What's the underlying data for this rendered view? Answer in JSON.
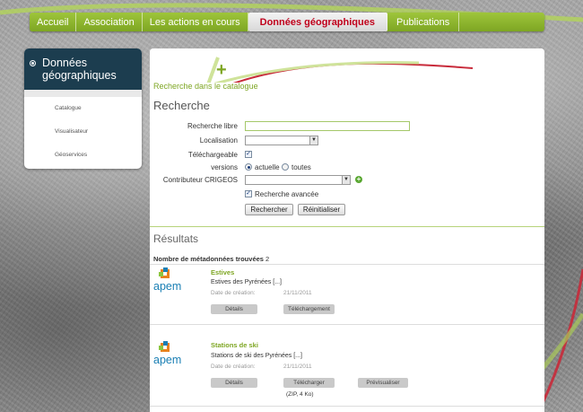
{
  "colors": {
    "nav_green": "#8fb82f",
    "nav_active_text": "#c0001b",
    "sidebar_header": "#1c3d4f",
    "link_green": "#7ea623",
    "apem_blue": "#1a7fb4"
  },
  "nav": {
    "items": [
      {
        "label": "Accueil"
      },
      {
        "label": "Association"
      },
      {
        "label": "Les actions en cours"
      },
      {
        "label": "Données géographiques",
        "active": true
      },
      {
        "label": "Publications"
      }
    ]
  },
  "sidebar": {
    "title_line1": "Données",
    "title_line2": "géographiques",
    "items": [
      {
        "label": "Catalogue"
      },
      {
        "label": "Visualisateur"
      },
      {
        "label": "Géoservices"
      }
    ]
  },
  "main": {
    "breadcrumb": "Recherche dans le catalogue",
    "title": "Recherche"
  },
  "form": {
    "free_search_label": "Recherche libre",
    "free_search_value": "",
    "localisation_label": "Localisation",
    "localisation_value": "",
    "telechargeable_label": "Téléchargeable",
    "telechargeable_checked": true,
    "versions_label": "versions",
    "version_current": "actuelle",
    "version_all": "toutes",
    "contributeur_label": "Contributeur CRIGEOS",
    "contributeur_value": "",
    "advanced_label": "Recherche avancée",
    "advanced_checked": true,
    "search_button": "Rechercher",
    "reset_button": "Réinitialiser"
  },
  "results": {
    "title": "Résultats",
    "count_label": "Nombre de métadonnées trouvées",
    "count": "2",
    "items": [
      {
        "logo_text": "apem",
        "title": "Estives",
        "description": "Estives des Pyrénées [...]",
        "date_label": "Date de création:",
        "date": "21/11/2011",
        "buttons": [
          "Détails",
          "Téléchargement"
        ]
      },
      {
        "logo_text": "apem",
        "title": "Stations de ski",
        "description": "Stations de ski des Pyrénées [...]",
        "date_label": "Date de création:",
        "date": "21/11/2011",
        "buttons": [
          "Détails",
          "Télécharger",
          "Prévisualiser"
        ],
        "download_note": "(ZIP, 4 Ko)"
      }
    ]
  }
}
